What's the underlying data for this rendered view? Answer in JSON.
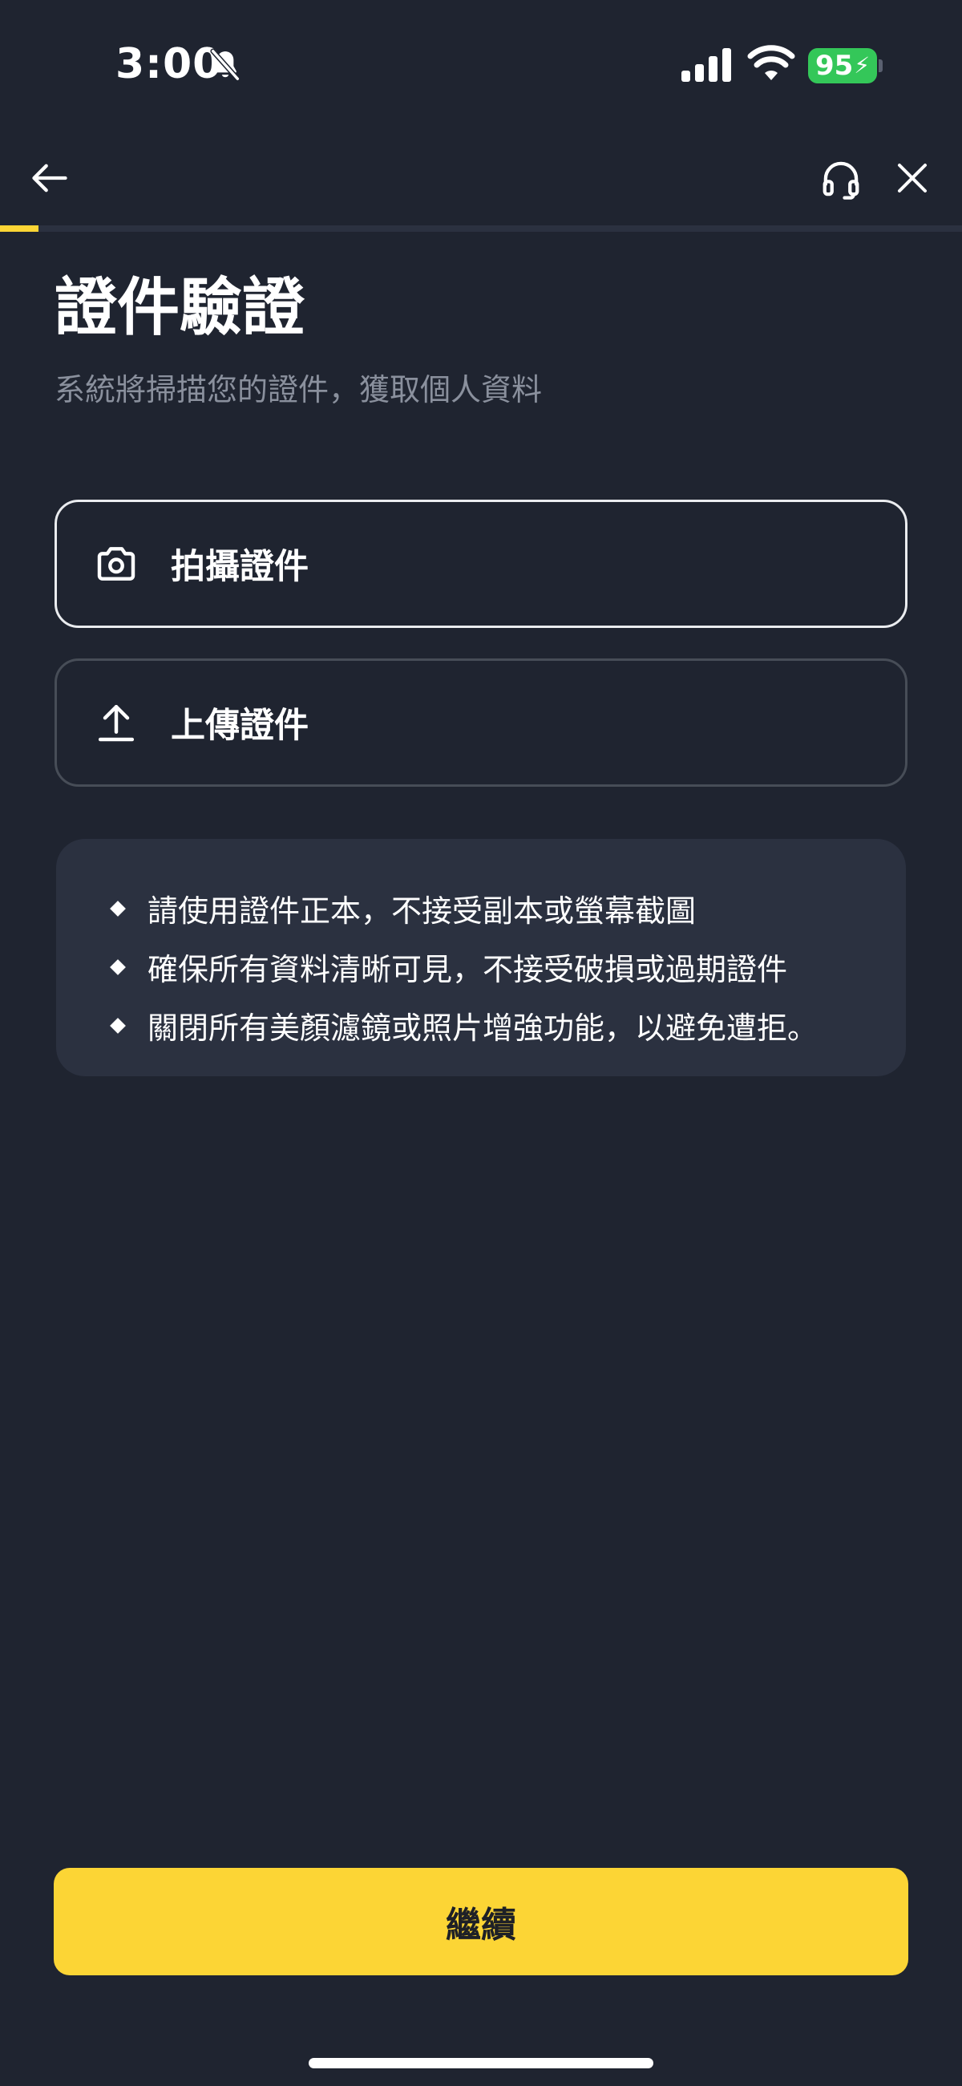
{
  "status_bar": {
    "time": "3:00",
    "battery_level": "95",
    "battery_charging_glyph": "⚡",
    "icons": [
      "bell-slash-icon",
      "cellular-signal-icon",
      "wifi-icon",
      "battery-icon"
    ]
  },
  "nav": {
    "icons": [
      "back-arrow-icon",
      "headset-icon",
      "close-icon"
    ],
    "progress_fraction": 0.04
  },
  "header": {
    "title": "證件驗證",
    "subtitle": "系統將掃描您的證件，獲取個人資料"
  },
  "options": {
    "take_photo_label": "拍攝證件",
    "take_photo_icon": "camera-icon",
    "upload_label": "上傳證件",
    "upload_icon": "upload-icon"
  },
  "tips": [
    "請使用證件正本，不接受副本或螢幕截圖",
    "確保所有資料清晰可見，不接受破損或過期證件",
    "關閉所有美顏濾鏡或照片增強功能，以避免遭拒。"
  ],
  "footer": {
    "continue_label": "繼續"
  },
  "colors": {
    "background": "#1F2430",
    "accent": "#FCD535",
    "card": "#2B3140",
    "muted_text": "#8A909D",
    "battery": "#34C759"
  }
}
